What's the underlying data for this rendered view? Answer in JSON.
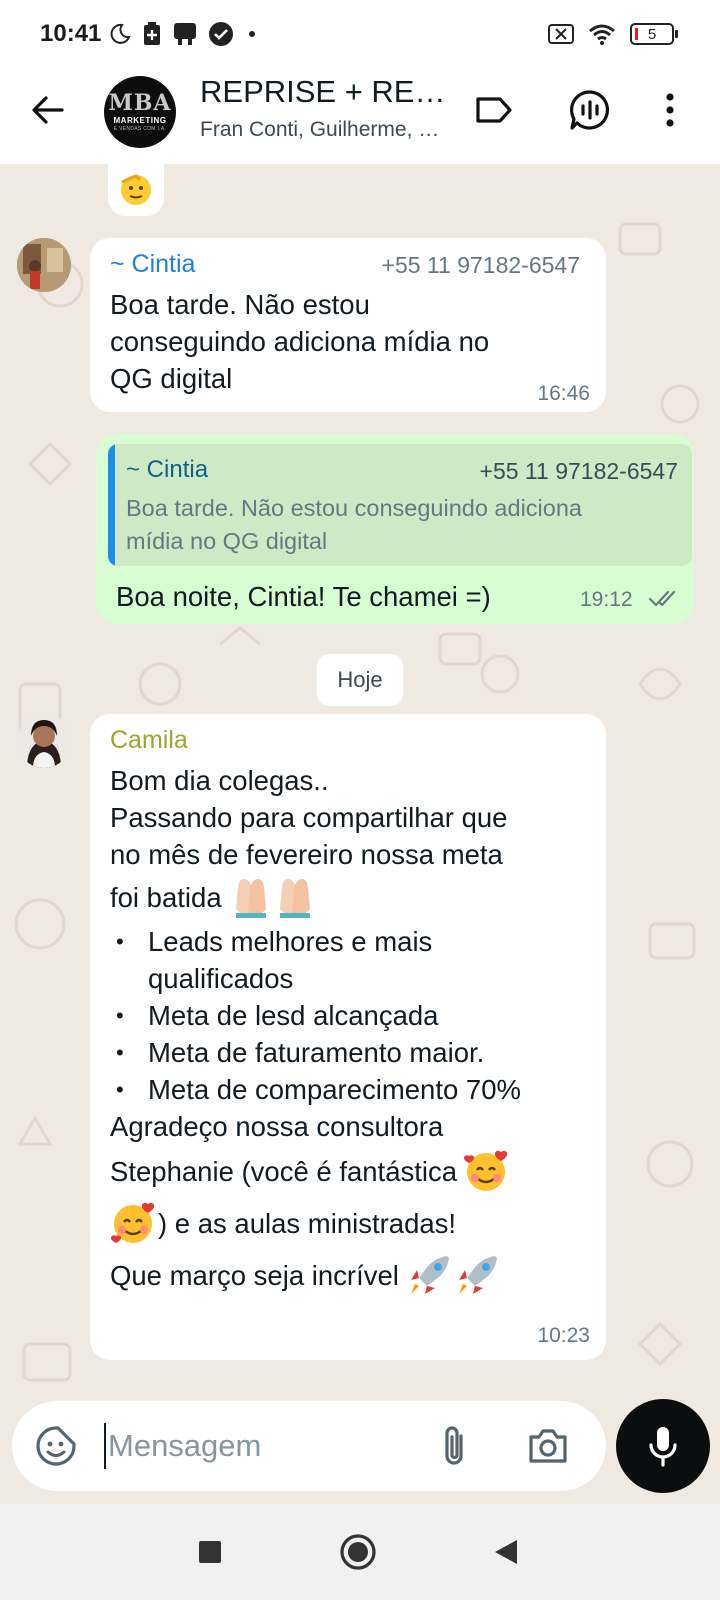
{
  "status_bar": {
    "time": "10:41",
    "battery_level": "5",
    "icons_left": [
      "moon-icon",
      "battery-saver-icon",
      "notification-icon",
      "check-circle-icon",
      "dot-icon"
    ],
    "icons_right": [
      "no-sim-icon",
      "wifi-icon",
      "battery-icon"
    ]
  },
  "header": {
    "title": "REPRISE + RESULTADOS",
    "subtitle": "Fran Conti, Guilherme, Cintia, Camila",
    "avatar_logo": {
      "main": "MBA",
      "line1": "MARKETING",
      "line2": "E VENDAS COM I.A."
    },
    "icons": [
      "back-arrow-icon",
      "label-icon",
      "voice-chat-icon",
      "more-vert-icon"
    ]
  },
  "messages": [
    {
      "id": "cintia-msg",
      "sender": "~ Cintia",
      "sender_color": "#1f7fe0",
      "phone": "+55 11 97182-6547",
      "text_lines": [
        "Boa tarde. Não estou",
        "conseguindo adiciona mídia no",
        "QG digital"
      ],
      "time": "16:46"
    },
    {
      "id": "reply-msg",
      "quote": {
        "sender": "~ Cintia",
        "phone": "+55 11 97182-6547",
        "lines": [
          "Boa tarde. Não estou conseguindo adiciona",
          "mídia no QG digital"
        ]
      },
      "text": "Boa noite, Cintia! Te chamei =)",
      "time": "19:12",
      "status": "read"
    },
    {
      "id": "camila-msg",
      "sender": "Camila",
      "sender_color": "#9ea42e",
      "intro_lines": [
        "Bom dia colegas..",
        "Passando para compartilhar que",
        "no mês de fevereiro nossa meta",
        "foi batida"
      ],
      "bullets": [
        [
          "Leads melhores e mais",
          "qualificados"
        ],
        [
          "Meta de lesd alcançada"
        ],
        [
          "Meta de faturamento maior."
        ],
        [
          "Meta de comparecimento 70%"
        ]
      ],
      "outro": {
        "line1": "Agradeço nossa consultora",
        "line2": "Stephanie (você é fantástica",
        "line3": ") e as aulas ministradas!",
        "line4": "Que março seja incrível"
      },
      "time": "10:23"
    }
  ],
  "date_separator": "Hoje",
  "composer": {
    "placeholder": "Mensagem",
    "icons": [
      "sticker-icon",
      "attach-icon",
      "camera-icon",
      "mic-icon"
    ]
  },
  "nav": {
    "icons": [
      "recents-icon",
      "home-icon",
      "back-icon"
    ]
  },
  "colors": {
    "incoming_bubble": "#ffffff",
    "outgoing_bubble": "#d9fdd3",
    "chat_background": "#efe9e1",
    "quote_bar": "#1b8cf0"
  }
}
